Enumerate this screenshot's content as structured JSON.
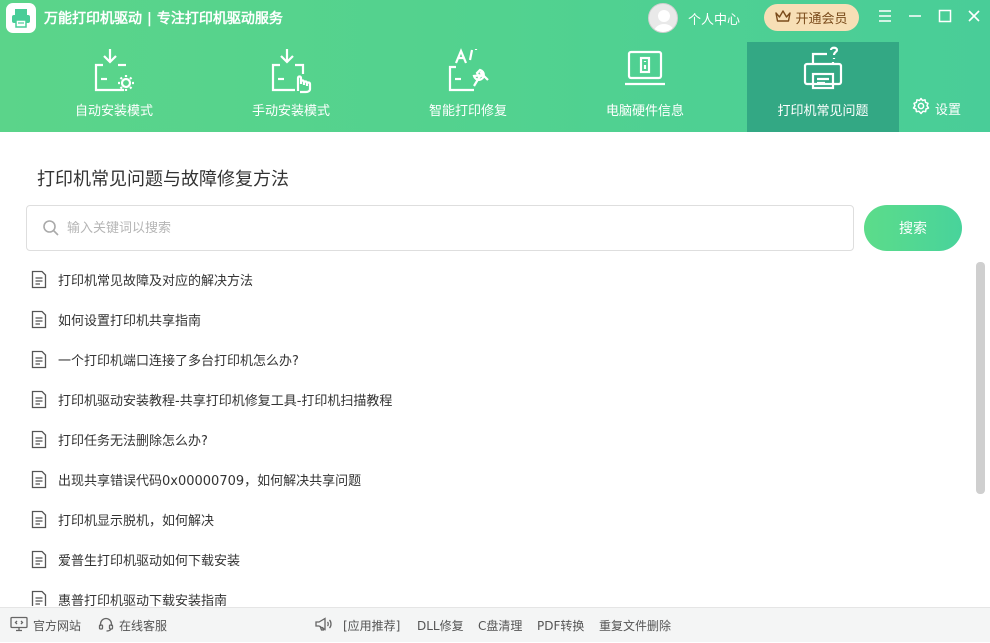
{
  "app": {
    "title": "万能打印机驱动 | 专注打印机驱动服务",
    "personal_center": "个人中心",
    "vip_button": "开通会员"
  },
  "nav": {
    "tabs": [
      {
        "label": "自动安装模式",
        "icon": "auto-install-icon",
        "active": false
      },
      {
        "label": "手动安装模式",
        "icon": "manual-install-icon",
        "active": false
      },
      {
        "label": "智能打印修复",
        "icon": "smart-repair-icon",
        "active": false
      },
      {
        "label": "电脑硬件信息",
        "icon": "hardware-info-icon",
        "active": false
      },
      {
        "label": "打印机常见问题",
        "icon": "printer-faq-icon",
        "active": true
      }
    ],
    "settings_label": "设置"
  },
  "main": {
    "title": "打印机常见问题与故障修复方法",
    "search": {
      "placeholder": "输入关键词以搜索",
      "value": "",
      "button_label": "搜索"
    },
    "faq_items": [
      "打印机常见故障及对应的解决方法",
      "如何设置打印机共享指南",
      "一个打印机端口连接了多台打印机怎么办?",
      "打印机驱动安装教程-共享打印机修复工具-打印机扫描教程",
      "打印任务无法删除怎么办?",
      "出现共享错误代码0x00000709，如何解决共享问题",
      "打印机显示脱机，如何解决",
      "爱普生打印机驱动如何下载安装",
      "惠普打印机驱动下载安装指南"
    ]
  },
  "footer": {
    "official_site": "官方网站",
    "online_service": "在线客服",
    "recommend_label": "[应用推荐]",
    "links": [
      "DLL修复",
      "C盘清理",
      "PDF转换",
      "重复文件删除"
    ]
  },
  "colors": {
    "header_start": "#5bd48a",
    "header_end": "#49cd98",
    "active_tab": "#33a884",
    "vip_bg": "#f7dfb6",
    "vip_text": "#7a4b1b"
  }
}
